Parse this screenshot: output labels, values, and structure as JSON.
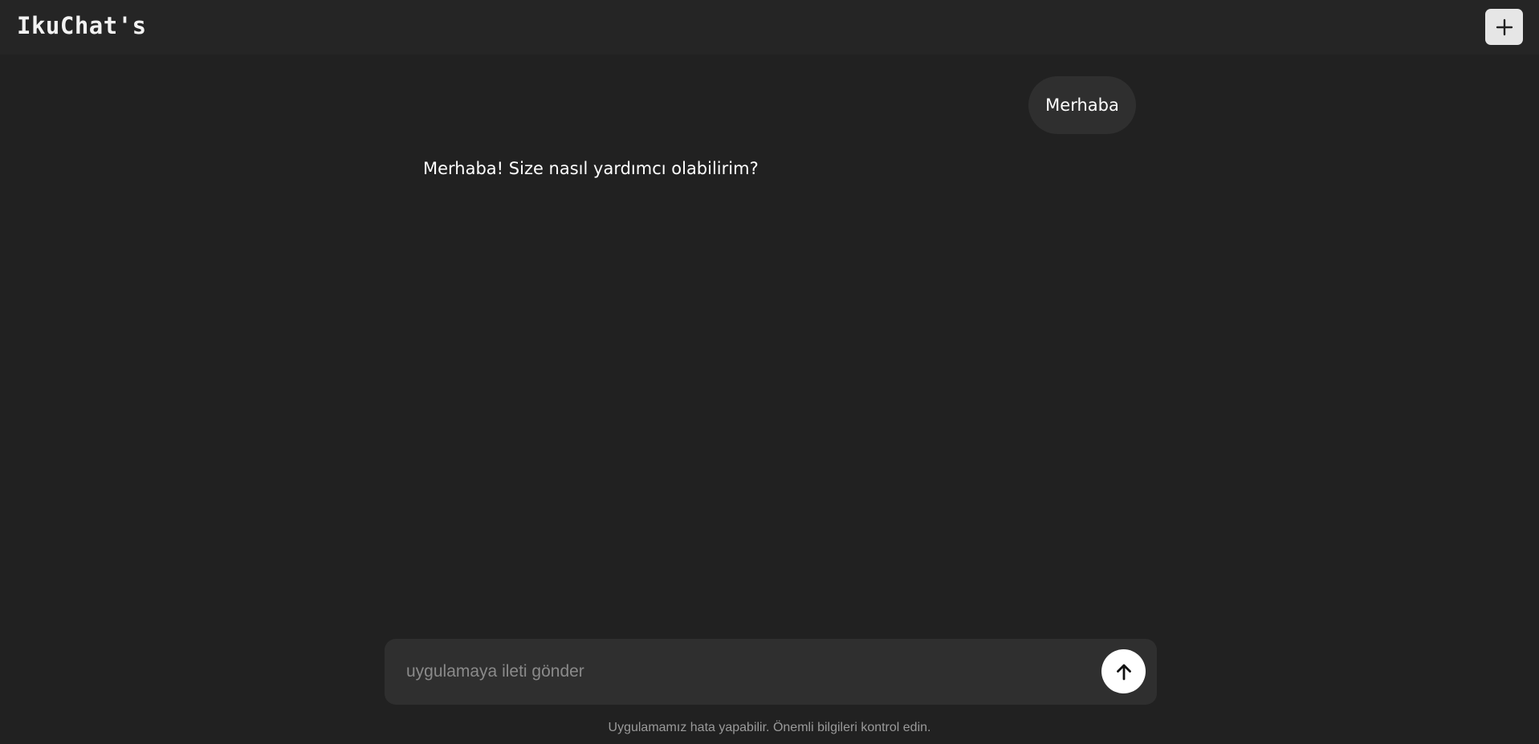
{
  "header": {
    "brand": "IkuChat's",
    "new_chat_icon": "plus-icon"
  },
  "conversation": {
    "user_message": "Merhaba",
    "assistant_message": "Merhaba! Size nasıl yardımcı olabilirim?"
  },
  "composer": {
    "placeholder": "uygulamaya ileti gönder",
    "value": "",
    "send_icon": "arrow-up-icon"
  },
  "footer": {
    "disclaimer": "Uygulamamız hata yapabilir. Önemli bilgileri kontrol edin."
  },
  "colors": {
    "background": "#212121",
    "header_background": "#252525",
    "bubble_background": "#2f2f2f",
    "composer_background": "#2f2f2f",
    "new_chat_button": "#e6e6e6",
    "send_button": "#ffffff",
    "placeholder_text": "#8a8a8a",
    "disclaimer_text": "#9a9a9a"
  }
}
